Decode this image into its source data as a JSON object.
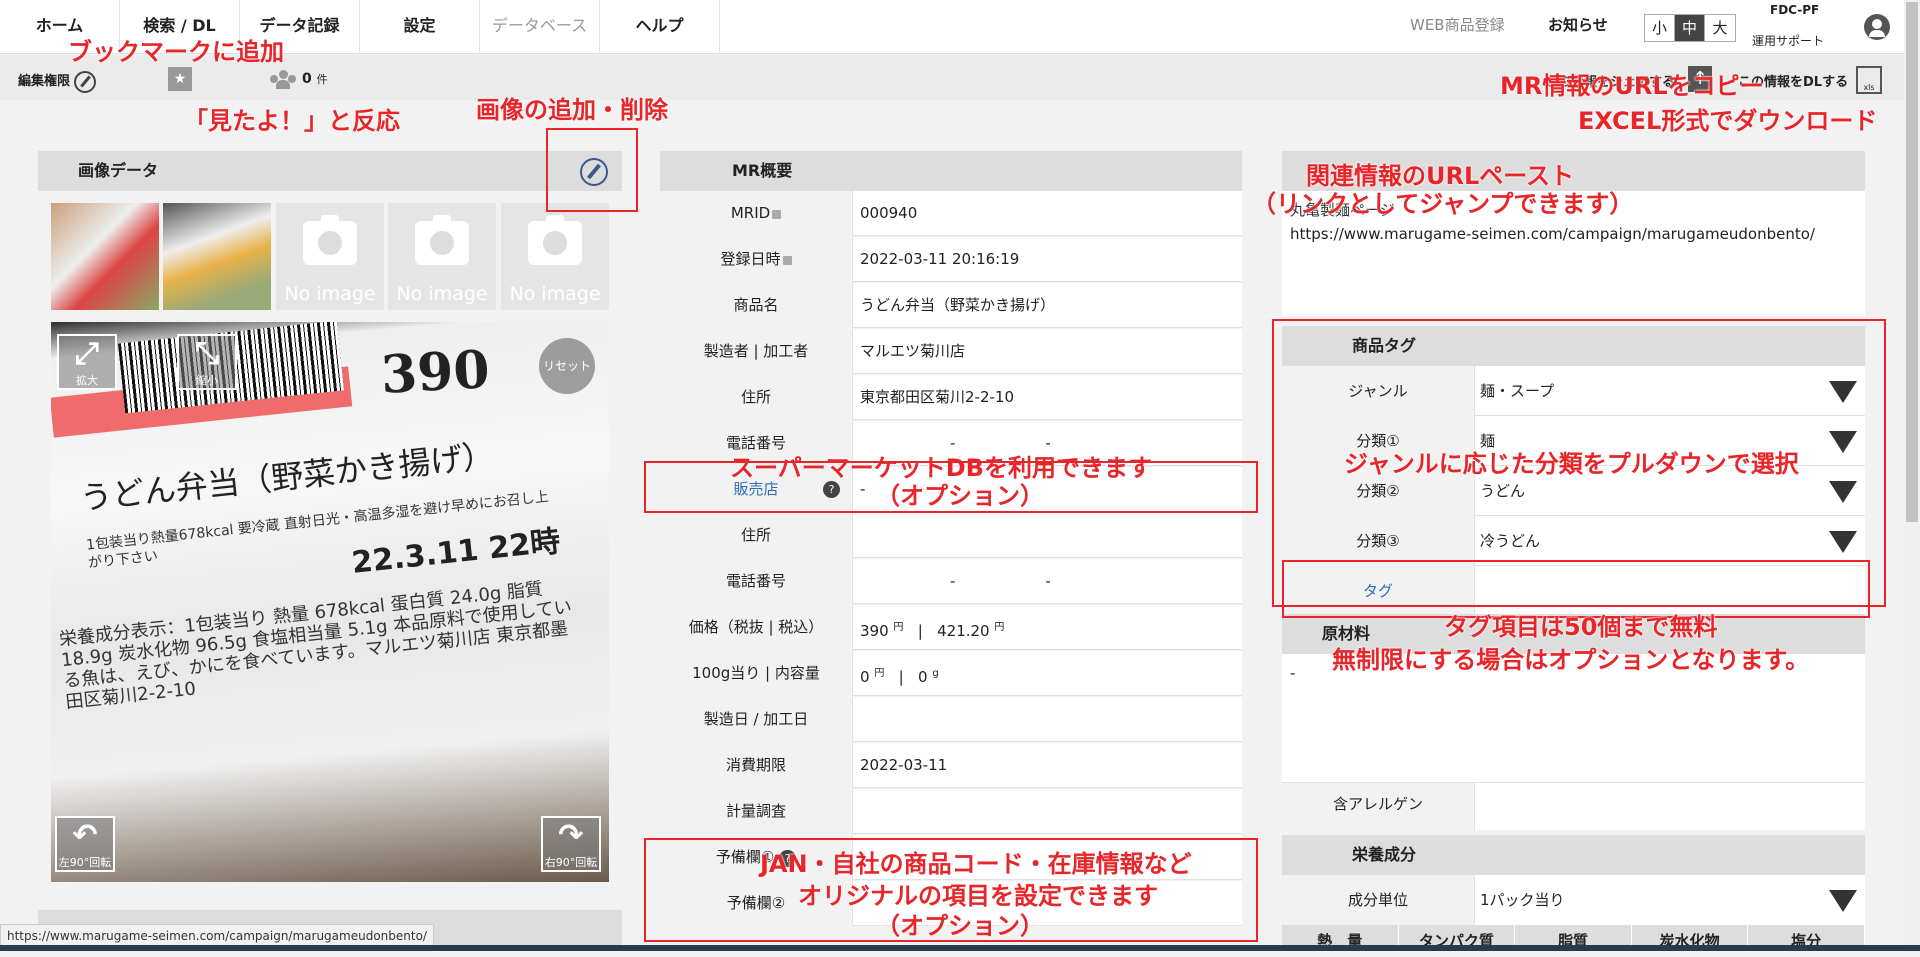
{
  "nav": {
    "home": "ホーム",
    "search": "検索 / DL",
    "records": "データ記録",
    "settings": "設定",
    "database": "データベース",
    "help": "ヘルプ",
    "web_register": "WEB商品登録",
    "notice": "お知らせ",
    "size_small": "小",
    "size_medium": "中",
    "size_large": "大",
    "org": "FDC-PF",
    "support": "運用サポート"
  },
  "toolbar": {
    "edit_permission": "編集権限",
    "reaction_count": "0",
    "reaction_unit": "件",
    "share": "この情報をシェアする",
    "share_glyph": "↑",
    "download": "この情報をDLする",
    "xls": "xls"
  },
  "image_panel": {
    "title": "画像データ",
    "no_image": "No image",
    "photo": {
      "price": "390",
      "name": "うどん弁当（野菜かき揚げ）",
      "info": "1包装当り熱量678kcal 要冷蔵 直射日光・高温多湿を避け早めにお召し上がり下さい",
      "date_line": "22.3.11 22時",
      "nutrition": "栄養成分表示：1包装当り 熱量 678kcal 蛋白質 24.0g 脂質 18.9g 炭水化物 96.5g 食塩相当量 5.1g 本品原料で使用している魚は、えび、かにを食べています。マルエツ菊川店 東京都墨田区菊川2-2-10",
      "zoom_in": "拡大",
      "zoom_out": "縮小",
      "reset": "リセット",
      "rotate_left": "左90°回転",
      "rotate_right": "右90°回転"
    }
  },
  "mr": {
    "title": "MR概要",
    "rows": [
      {
        "label": "MRID",
        "value": "000940"
      },
      {
        "label": "登録日時",
        "value": "2022-03-11 20:16:19"
      },
      {
        "label": "商品名",
        "value": "うどん弁当（野菜かき揚げ）"
      },
      {
        "label": "製造者 | 加工者",
        "value": "マルエツ菊川店"
      },
      {
        "label": "住所",
        "value": "東京都田区菊川2-2-10"
      },
      {
        "label": "電話番号",
        "value": "-　　　　　　-"
      },
      {
        "label": "販売店",
        "value": "-"
      },
      {
        "label": "住所",
        "value": ""
      },
      {
        "label": "電話番号",
        "value": "-　　　　　　-"
      },
      {
        "label": "価格（税抜 | 税込）",
        "value": ""
      },
      {
        "label": "100g当り | 内容量",
        "value": ""
      },
      {
        "label": "製造日 / 加工日",
        "value": ""
      },
      {
        "label": "消費期限",
        "value": "2022-03-11"
      },
      {
        "label": "計量調査",
        "value": ""
      },
      {
        "label": "予備欄①",
        "value": ""
      },
      {
        "label": "予備欄②",
        "value": ""
      }
    ],
    "price_ex": "390",
    "price_in": "421.20",
    "yen": "円",
    "per100": "0",
    "content": "0",
    "gram": "g",
    "sep": "|",
    "qmark": "?"
  },
  "related": {
    "label": "丸亀製麺ページ",
    "url": "https://www.marugame-seimen.com/campaign/marugameudonbento/"
  },
  "tags": {
    "title": "商品タグ",
    "rows": [
      {
        "label": "ジャンル",
        "value": "麺・スープ"
      },
      {
        "label": "分類①",
        "value": "麺"
      },
      {
        "label": "分類②",
        "value": "うどん"
      },
      {
        "label": "分類③",
        "value": "冷うどん"
      },
      {
        "label": "タグ",
        "value": ""
      }
    ]
  },
  "materials": {
    "title": "原材料",
    "value": "-",
    "allergy": "含アレルゲン"
  },
  "nutrition": {
    "title": "栄養成分",
    "unit_label": "成分単位",
    "unit_value": "1パック当り",
    "cols": [
      "熱　量",
      "タンパク質",
      "脂質",
      "炭水化物",
      "塩分"
    ]
  },
  "annotations": {
    "bookmark": "ブックマークに追加",
    "reaction": "「見たよ！」と反応",
    "image_edit": "画像の追加・削除",
    "copy_url": "MR情報のURLをコピー",
    "excel": "EXCEL形式でダウンロード",
    "related_1": "関連情報のURLペースト",
    "related_2": "（リンクとしてジャンプできます）",
    "supermarket_1": "スーパーマーケットDBを利用できます",
    "supermarket_2": "（オプション）",
    "genre": "ジャンルに応じた分類をプルダウンで選択",
    "tag_1": "タグ項目は50個まで無料",
    "tag_2": "無制限にする場合はオプションとなります。",
    "custom_1": "JAN・自社の商品コード・在庫情報など",
    "custom_2": "オリジナルの項目を設定できます",
    "custom_3": "（オプション）"
  },
  "status_url": "https://www.marugame-seimen.com/campaign/marugameudonbento/",
  "colors": {
    "annotation": "#e8262a",
    "link": "#2a6ebb"
  }
}
